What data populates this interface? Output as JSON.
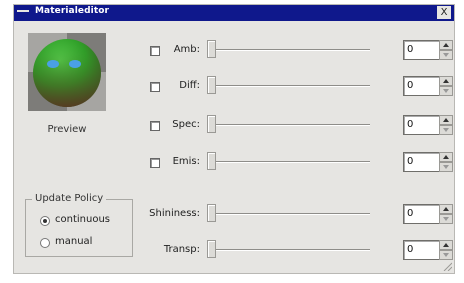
{
  "window": {
    "title": "Materialeditor",
    "close_glyph": "X"
  },
  "preview": {
    "label": "Preview"
  },
  "update_policy": {
    "title": "Update Policy",
    "options": [
      {
        "label": "continuous",
        "selected": true
      },
      {
        "label": "manual",
        "selected": false
      }
    ]
  },
  "properties": [
    {
      "label": "Amb:",
      "checkbox": true,
      "checked": false,
      "value": "0"
    },
    {
      "label": "Diff:",
      "checkbox": true,
      "checked": false,
      "value": "0"
    },
    {
      "label": "Spec:",
      "checkbox": true,
      "checked": false,
      "value": "0"
    },
    {
      "label": "Emis:",
      "checkbox": true,
      "checked": false,
      "value": "0"
    },
    {
      "label": "Shininess:",
      "checkbox": false,
      "value": "0"
    },
    {
      "label": "Transp:",
      "checkbox": false,
      "value": "0"
    }
  ],
  "colors": {
    "titlebar": "#0f188c",
    "window_bg": "#e6e5e2",
    "sphere": "#2fa82a",
    "sphere_highlight": "#4aa0e6"
  }
}
